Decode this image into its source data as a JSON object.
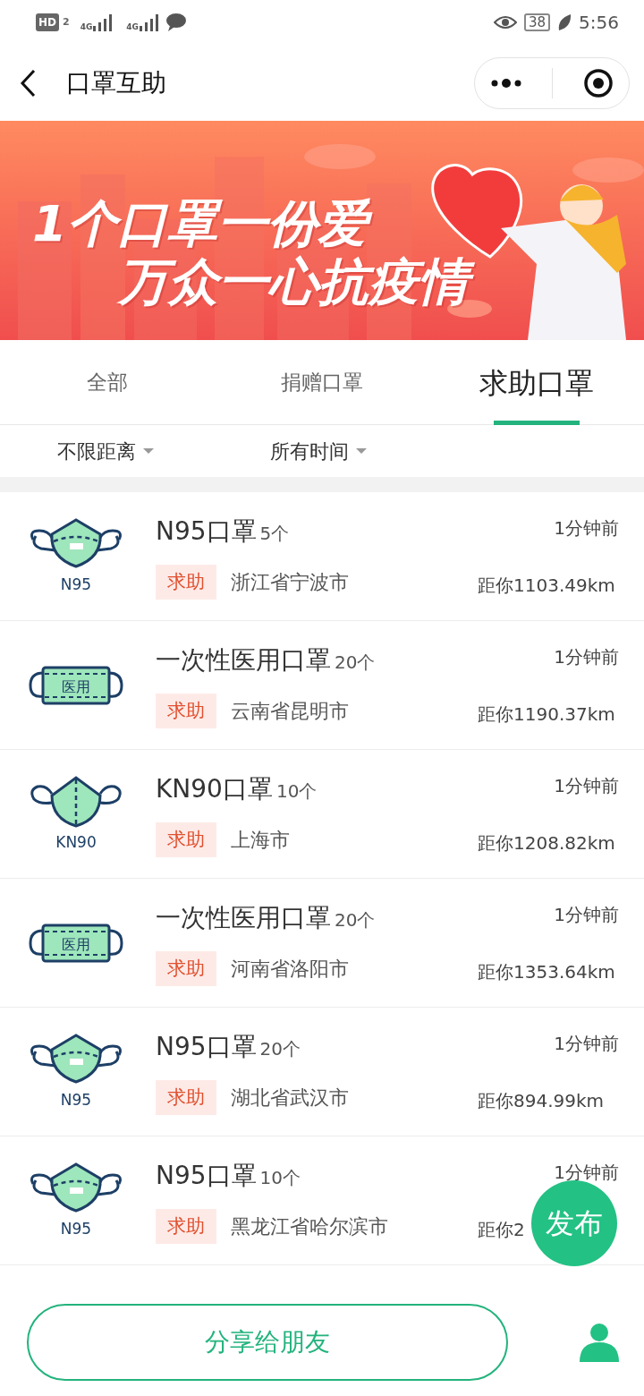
{
  "status_bar": {
    "left_badges": [
      "HD",
      "2"
    ],
    "signal_labels": [
      "4G",
      "4G"
    ],
    "battery": "38",
    "time": "5:56"
  },
  "header": {
    "title": "口罩互助"
  },
  "banner": {
    "line_1": "1个口罩一份爱",
    "line_2": "万众一心抗疫情"
  },
  "tabs": [
    {
      "label": "全部",
      "selected": false
    },
    {
      "label": "捐赠口罩",
      "selected": false
    },
    {
      "label": "求助口罩",
      "selected": true
    }
  ],
  "filters": [
    {
      "label": "不限距离"
    },
    {
      "label": "所有时间"
    }
  ],
  "items": [
    {
      "kind": "n95",
      "icon_label": "N95",
      "name": "N95口罩",
      "quantity": "5个",
      "tag": "求助",
      "place": "浙江省宁波市",
      "time": "1分钟前",
      "distance": "距你1103.49km"
    },
    {
      "kind": "medical",
      "icon_label": "医用",
      "name": "一次性医用口罩",
      "quantity": "20个",
      "tag": "求助",
      "place": "云南省昆明市",
      "time": "1分钟前",
      "distance": "距你1190.37km"
    },
    {
      "kind": "kn90",
      "icon_label": "KN90",
      "name": "KN90口罩",
      "quantity": "10个",
      "tag": "求助",
      "place": "上海市",
      "time": "1分钟前",
      "distance": "距你1208.82km"
    },
    {
      "kind": "medical",
      "icon_label": "医用",
      "name": "一次性医用口罩",
      "quantity": "20个",
      "tag": "求助",
      "place": "河南省洛阳市",
      "time": "1分钟前",
      "distance": "距你1353.64km"
    },
    {
      "kind": "n95",
      "icon_label": "N95",
      "name": "N95口罩",
      "quantity": "20个",
      "tag": "求助",
      "place": "湖北省武汉市",
      "time": "1分钟前",
      "distance": "距你894.99km"
    },
    {
      "kind": "n95",
      "icon_label": "N95",
      "name": "N95口罩",
      "quantity": "10个",
      "tag": "求助",
      "place": "黑龙江省哈尔滨市",
      "time": "1分钟前",
      "distance": "距你2"
    }
  ],
  "publish_button": "发布",
  "share_button": "分享给朋友"
}
